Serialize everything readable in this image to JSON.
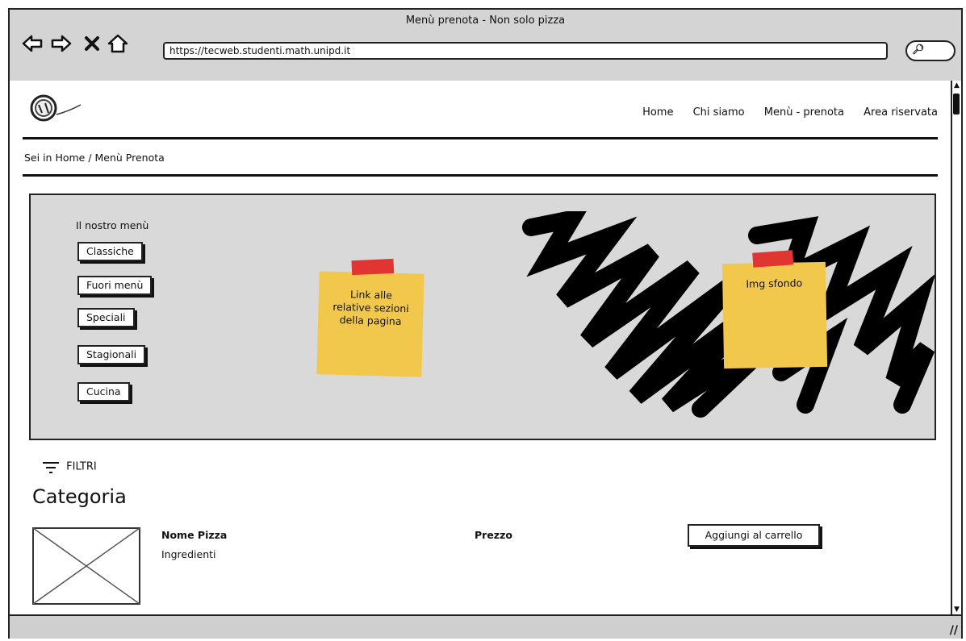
{
  "window": {
    "title": "Menù prenota - Non solo pizza"
  },
  "browser": {
    "url": "https://tecweb.studenti.math.unipd.it",
    "search_icon": "search-icon",
    "icons": [
      "back-arrow-icon",
      "forward-arrow-icon",
      "close-x-icon",
      "home-icon"
    ]
  },
  "site": {
    "logo_icon": "logo-image",
    "nav": [
      {
        "label": "Home"
      },
      {
        "label": "Chi siamo"
      },
      {
        "label": "Menù - prenota"
      },
      {
        "label": "Area riservata"
      }
    ],
    "breadcrumb": "Sei in Home / Menù Prenota"
  },
  "hero": {
    "menu_title": "Il nostro menù",
    "menu_buttons": [
      {
        "label": "Classiche"
      },
      {
        "label": "Fuori menù"
      },
      {
        "label": "Speciali"
      },
      {
        "label": "Stagionali"
      },
      {
        "label": "Cucina"
      }
    ],
    "note_links": "Link alle relative sezioni della pagina",
    "note_bg": "Img sfondo",
    "colors": {
      "note": "#f2c84c",
      "tape": "#e03530",
      "hero_bg": "#d9d9d9"
    }
  },
  "main": {
    "filter_label": "FILTRI",
    "filter_icon": "filter-icon",
    "category_title": "Categoria",
    "product": {
      "name": "Nome Pizza",
      "ingredients": "Ingredienti",
      "price": "Prezzo",
      "cart_label": "Aggiungi al carrello",
      "image_icon": "image-placeholder-icon"
    }
  }
}
